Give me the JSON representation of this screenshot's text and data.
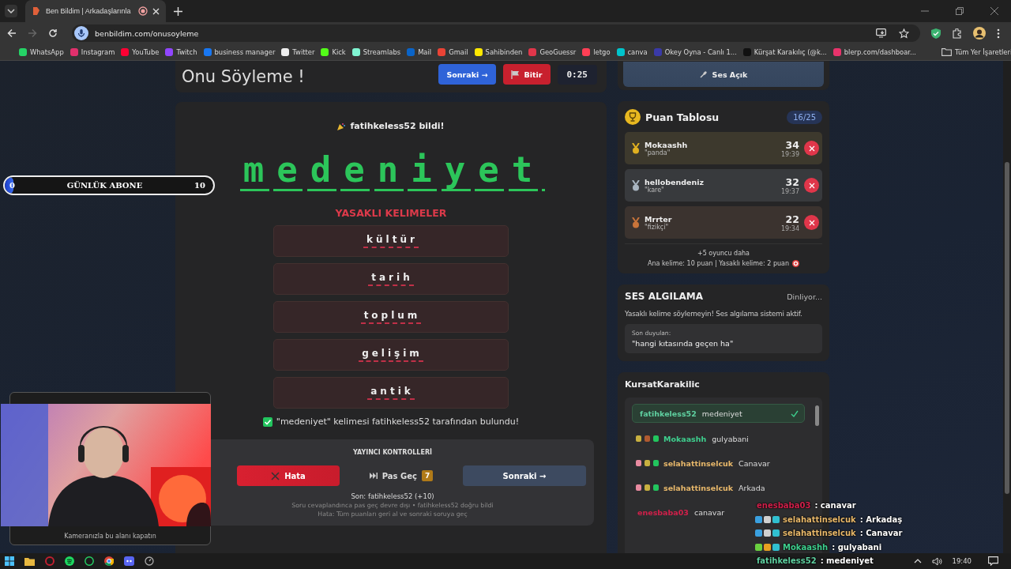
{
  "browser": {
    "tab": {
      "title": "Ben Bildim | Arkadaşlarınla",
      "recording": true
    },
    "url": "benbildim.com/onusoyleme",
    "bookmarks": [
      {
        "label": "WhatsApp",
        "color": "#25d366"
      },
      {
        "label": "Instagram",
        "color": "#e1306c"
      },
      {
        "label": "YouTube",
        "color": "#ff0033"
      },
      {
        "label": "Twitch",
        "color": "#9146ff"
      },
      {
        "label": "business manager",
        "color": "#1877f2"
      },
      {
        "label": "Twitter",
        "color": "#eeeeee"
      },
      {
        "label": "Kick",
        "color": "#53fc18"
      },
      {
        "label": "Streamlabs",
        "color": "#80f5d2"
      },
      {
        "label": "Mail",
        "color": "#0a64c8"
      },
      {
        "label": "Gmail",
        "color": "#ea4335"
      },
      {
        "label": "Sahibinden",
        "color": "#ffe800"
      },
      {
        "label": "GeoGuessr",
        "color": "#e0364a"
      },
      {
        "label": "letgo",
        "color": "#ff3f55"
      },
      {
        "label": "canva",
        "color": "#00c4cc"
      },
      {
        "label": "Okey Oyna - Canlı 1...",
        "color": "#3a3aa8"
      },
      {
        "label": "Kürşat Karakılıç (@k...",
        "color": "#111111"
      },
      {
        "label": "blerp.com/dashboar...",
        "color": "#e8336b"
      }
    ],
    "all_bookmarks": "Tüm Yer İşaretleri"
  },
  "subscriber_goal": {
    "current": "0",
    "label": "GÜNLÜK ABONE",
    "goal": "10",
    "level": 0.04
  },
  "game": {
    "title": "Onu Söyleme !",
    "next_button": "Sonraki →",
    "finish_button": "Bitir",
    "timer": "0:25",
    "guessed_banner": "fatihkeless52 bildi!",
    "word": "medeniyet",
    "forbidden_title": "YASAKLI KELIMELER",
    "forbidden_words": [
      "kültür",
      "tarih",
      "toplum",
      "gelişim",
      "antik"
    ],
    "found_message": "\"medeniyet\" kelimesi fatihkeless52 tarafından bulundu!",
    "controls": {
      "title": "YAYINCI KONTROLLERİ",
      "buttons": [
        {
          "kind": "danger",
          "label": "Hata"
        },
        {
          "kind": "skip",
          "label": "Pas Geç",
          "count": "7"
        },
        {
          "kind": "next",
          "label": "Sonraki →"
        }
      ],
      "last": "Son: fatihkeless52 (+10)",
      "notes": [
        "Soru cevaplandınca pas geç devre dışı • fatihkeless52 doğru bildi",
        "Hata: Tüm puanları geri al ve sonraki soruya geç"
      ]
    }
  },
  "sound_button": "Ses Açık",
  "leaderboard": {
    "title": "Puan Tablosu",
    "count": "16/25",
    "entries": [
      {
        "name": "Mokaashh",
        "word": "\"panda\"",
        "score": "34",
        "time": "19:39",
        "color": "#e0b020"
      },
      {
        "name": "hellobendeniz",
        "word": "\"kare\"",
        "score": "32",
        "time": "19:37",
        "color": "#a8b4c0"
      },
      {
        "name": "Mrrter",
        "word": "\"fizikçi\"",
        "score": "22",
        "time": "19:34",
        "color": "#c8743a"
      }
    ],
    "more": "+5 oyuncu daha",
    "rules": "Ana kelime: 10 puan | Yasaklı kelime: 2 puan"
  },
  "voice": {
    "title": "SES ALGILAMA",
    "status": "Dinliyor...",
    "warning": "Yasaklı kelime söylemeyin! Ses algılama sistemi aktif.",
    "last_label": "Son duyulan:",
    "last_text": "\"hangi kıtasında geçen ha\""
  },
  "chat": {
    "channel": "KursatKarakilic",
    "messages": [
      {
        "user": "fatihkeless52",
        "text": "medeniyet",
        "color": "#5fd0a0",
        "highlighted": true
      },
      {
        "user": "Mokaashh",
        "text": "gulyabani",
        "color": "#3ecf8e",
        "highlighted": false,
        "badges": [
          {
            "color": "#c8b040"
          },
          {
            "color": "#b05a30"
          },
          {
            "color": "#22c55e"
          }
        ]
      },
      {
        "user": "selahattinselcuk",
        "text": "Canavar",
        "color": "#e8b86a",
        "highlighted": false,
        "badges": [
          {
            "color": "#e88aa0"
          },
          {
            "color": "#c8b040"
          },
          {
            "color": "#22c55e"
          }
        ]
      },
      {
        "user": "selahattinselcuk",
        "text": "Arkada",
        "color": "#e8b86a",
        "highlighted": false,
        "badges": [
          {
            "color": "#e88aa0"
          },
          {
            "color": "#c8b040"
          },
          {
            "color": "#22c55e"
          }
        ]
      },
      {
        "user": "enesbaba03",
        "text": "canavar",
        "color": "#d0204a",
        "highlighted": false
      }
    ]
  },
  "stream_chat": [
    {
      "user": "enesbaba03",
      "text": ": canavar",
      "color": "#d0204a"
    },
    {
      "user": "selahattinselcuk",
      "text": ": Arkadaş",
      "color": "#e8b86a",
      "badges": [
        {
          "color": "#3aa0e0"
        },
        {
          "color": "#d0d0d0"
        },
        {
          "color": "#30c0d0"
        }
      ]
    },
    {
      "user": "selahattinselcuk",
      "text": ": Canavar",
      "color": "#e8b86a",
      "badges": [
        {
          "color": "#3aa0e0"
        },
        {
          "color": "#d0d0d0"
        },
        {
          "color": "#30c0d0"
        }
      ]
    },
    {
      "user": "Mokaashh",
      "text": ": gulyabani",
      "color": "#3ecf8e",
      "badges": [
        {
          "color": "#6ad040"
        },
        {
          "color": "#e8a020"
        },
        {
          "color": "#30c0d0"
        }
      ]
    },
    {
      "user": "fatihkeless52",
      "text": ": medeniyet",
      "color": "#5fd0a0"
    }
  ],
  "webcam": {
    "caption": "Kameranızla bu alanı kapatın"
  },
  "taskbar": {
    "time": "19:40"
  }
}
